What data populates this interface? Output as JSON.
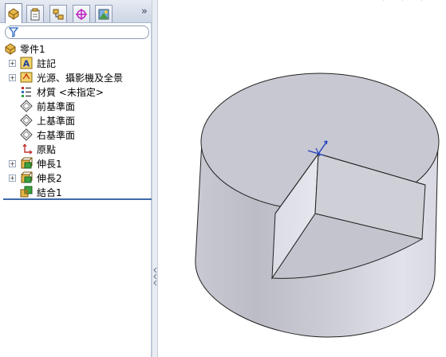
{
  "tabs": [
    {
      "name": "FeatureManager",
      "icon": "feature-tree-icon"
    },
    {
      "name": "PropertyManager",
      "icon": "property-manager-icon"
    },
    {
      "name": "ConfigurationManager",
      "icon": "configuration-icon"
    },
    {
      "name": "DimXpert",
      "icon": "dimxpert-icon"
    },
    {
      "name": "Display",
      "icon": "display-manager-icon"
    }
  ],
  "more_glyph": "»",
  "tree": {
    "root_label": "零件1",
    "items": [
      {
        "label": "註記",
        "icon": "annotations-icon",
        "expandable": true
      },
      {
        "label": "光源、攝影機及全景",
        "icon": "lights-cameras-icon",
        "expandable": true
      },
      {
        "label": "材質 <未指定>",
        "icon": "material-icon",
        "expandable": false
      },
      {
        "label": "前基準面",
        "icon": "plane-icon",
        "expandable": false
      },
      {
        "label": "上基準面",
        "icon": "plane-icon",
        "expandable": false
      },
      {
        "label": "右基準面",
        "icon": "plane-icon",
        "expandable": false
      },
      {
        "label": "原點",
        "icon": "origin-icon",
        "expandable": false
      },
      {
        "label": "伸長1",
        "icon": "extrude-icon",
        "expandable": true
      },
      {
        "label": "伸長2",
        "icon": "extrude-icon",
        "expandable": true
      },
      {
        "label": "結合1",
        "icon": "combine-icon",
        "expandable": false
      }
    ]
  },
  "colors": {
    "selection_line": "#3d6aa8",
    "model_face": "#c8c8d2",
    "model_shadow": "#a9a9b6",
    "model_highlight": "#ebebf2"
  }
}
